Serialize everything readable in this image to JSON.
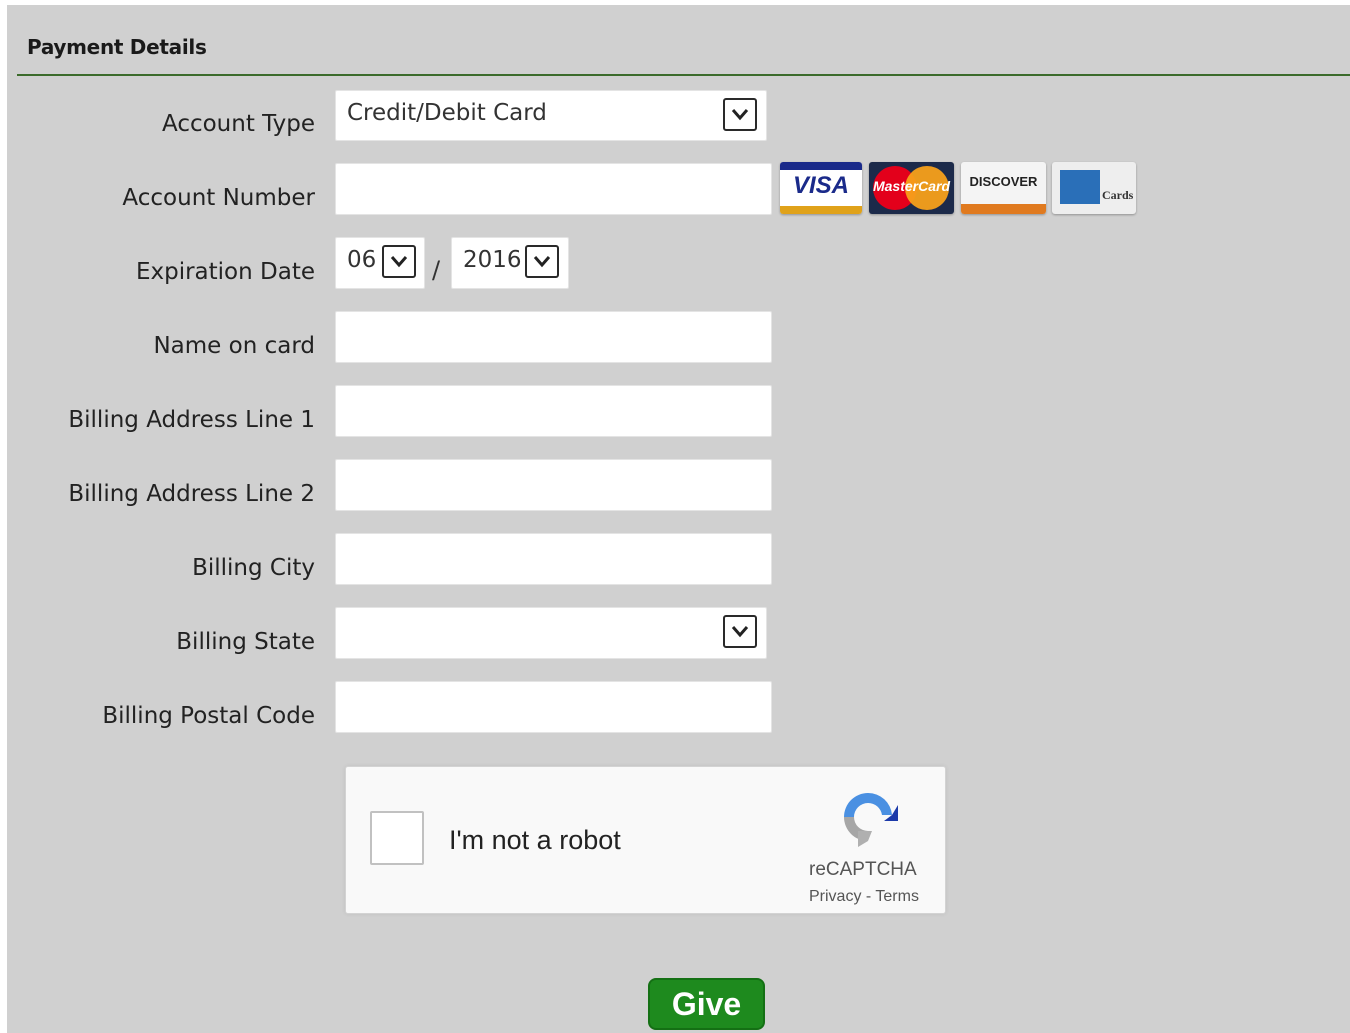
{
  "section": {
    "title": "Payment Details"
  },
  "form": {
    "account_type": {
      "label": "Account Type",
      "value": "Credit/Debit Card"
    },
    "account_number": {
      "label": "Account Number",
      "value": ""
    },
    "expiration": {
      "label": "Expiration Date",
      "month": "06",
      "separator": "/",
      "year": "2016"
    },
    "name_on_card": {
      "label": "Name on card",
      "value": ""
    },
    "address1": {
      "label": "Billing Address Line 1",
      "value": ""
    },
    "address2": {
      "label": "Billing Address Line 2",
      "value": ""
    },
    "city": {
      "label": "Billing City",
      "value": ""
    },
    "state": {
      "label": "Billing State",
      "value": ""
    },
    "postal": {
      "label": "Billing Postal Code",
      "value": ""
    }
  },
  "cards": {
    "visa": "VISA",
    "mastercard": "MasterCard",
    "discover": "DISCOVER",
    "amex": "Cards"
  },
  "recaptcha": {
    "checkbox_label": "I'm not a robot",
    "brand": "reCAPTCHA",
    "links": "Privacy - Terms"
  },
  "actions": {
    "give_label": "Give"
  },
  "colors": {
    "accent_green": "#1e8a1e",
    "rule": "#3b6b2b",
    "panel": "#d0d0d0"
  }
}
